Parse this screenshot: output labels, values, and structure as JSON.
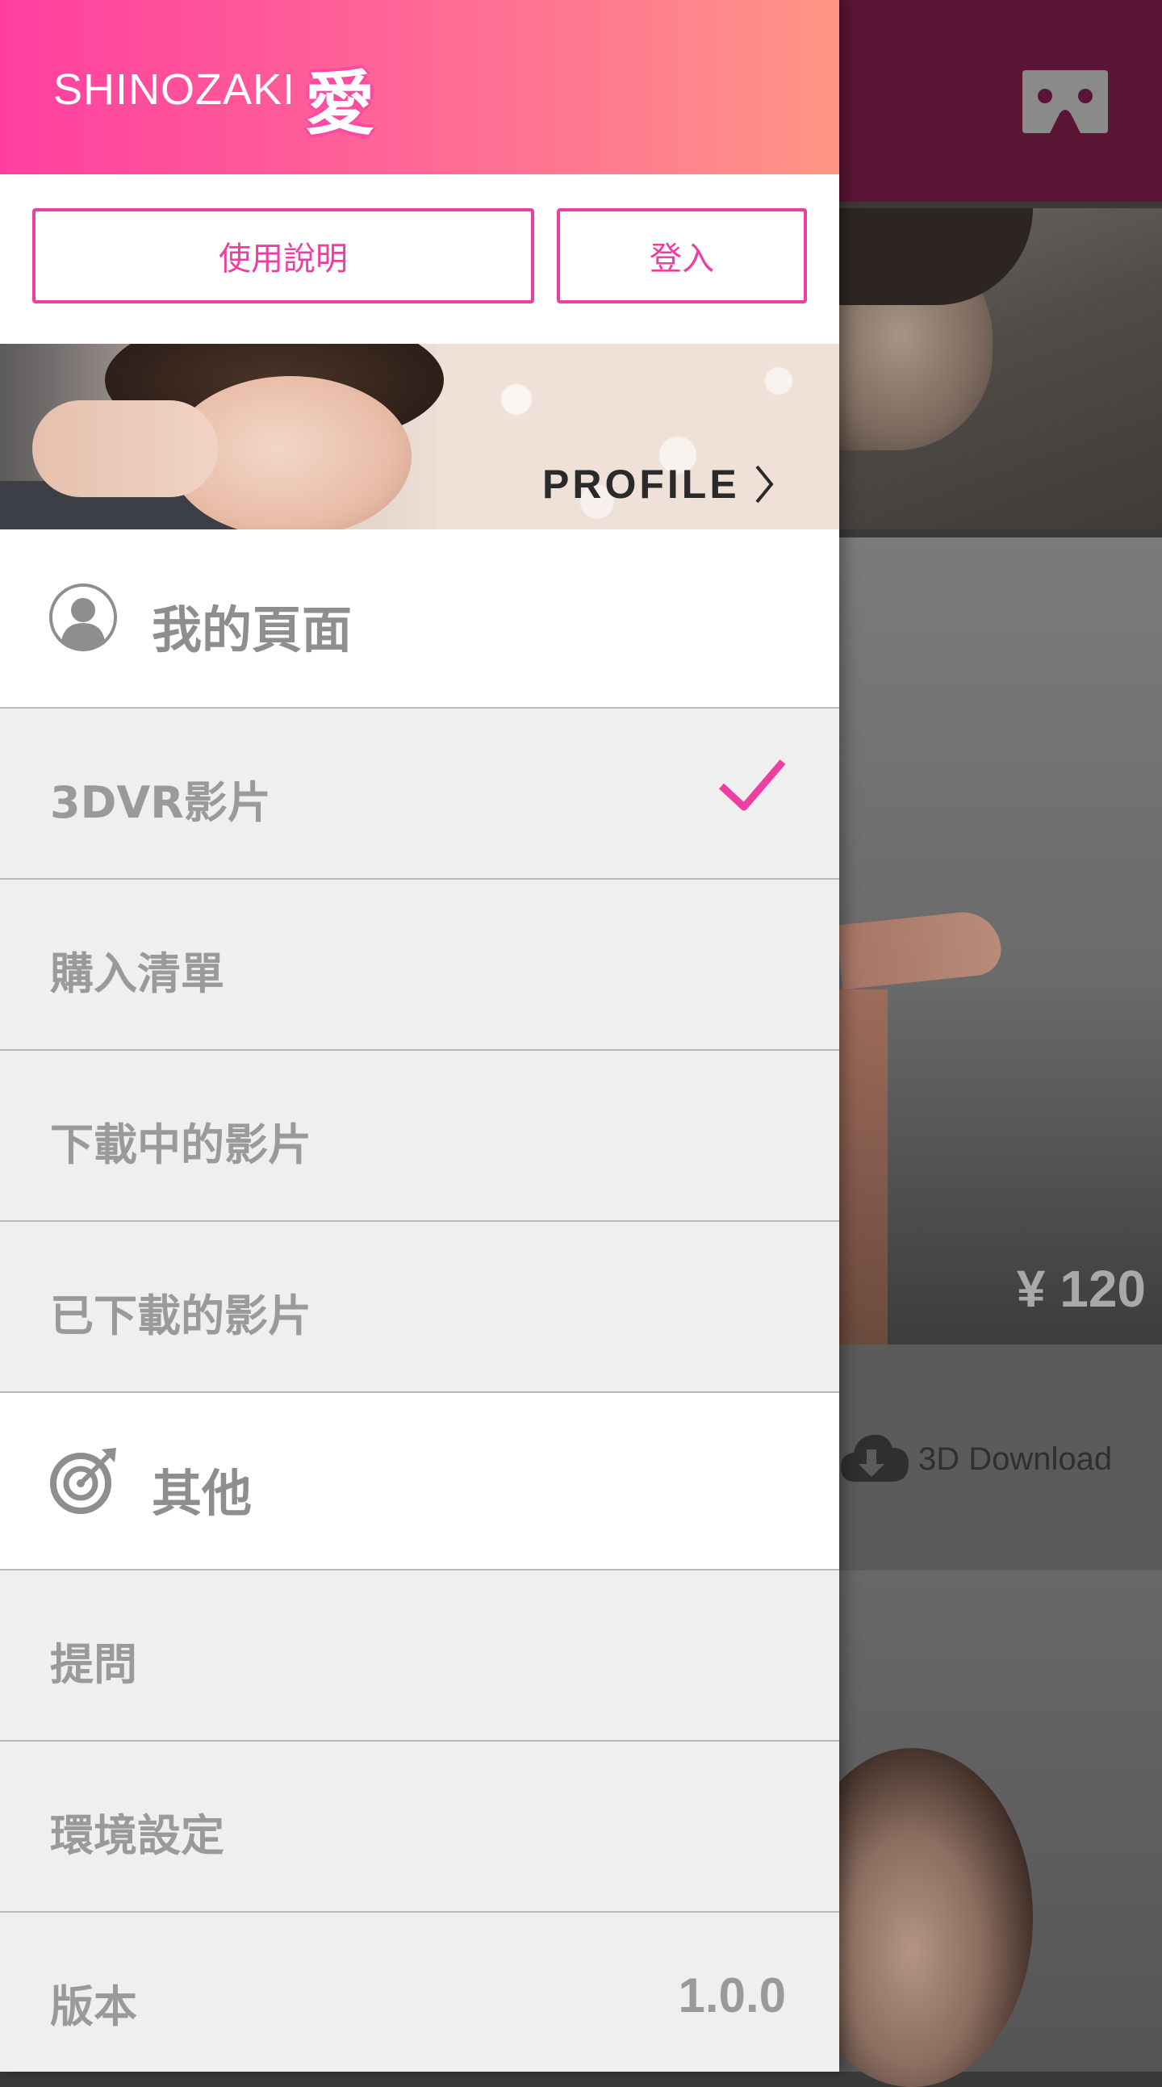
{
  "colors": {
    "accent": "#ec3fa1",
    "header_start": "#ff3fa0",
    "header_end": "#ff9585",
    "text_muted": "#9a9a9a"
  },
  "header": {
    "brand_name": "SHINOZAKI",
    "brand_kanji": "愛"
  },
  "buttons": {
    "guide_label": "使用說明",
    "login_label": "登入"
  },
  "banner": {
    "profile_label": "PROFILE"
  },
  "sections": {
    "mypage": {
      "title": "我的頁面",
      "icon": "user-avatar-icon"
    },
    "other": {
      "title": "其他",
      "icon": "target-icon"
    }
  },
  "menu": {
    "videos": {
      "label": "3DVR影片",
      "selected": true
    },
    "purchases": {
      "label": "購入清單"
    },
    "downloading": {
      "label": "下載中的影片"
    },
    "downloaded": {
      "label": "已下載的影片"
    },
    "questions": {
      "label": "提問"
    },
    "settings": {
      "label": "環境設定"
    },
    "version": {
      "label": "版本",
      "value": "1.0.0"
    }
  },
  "background": {
    "price": "¥ 120",
    "download_label": "3D Download",
    "vr_icon": "vr-headset-icon",
    "download_icon": "cloud-download-icon"
  }
}
